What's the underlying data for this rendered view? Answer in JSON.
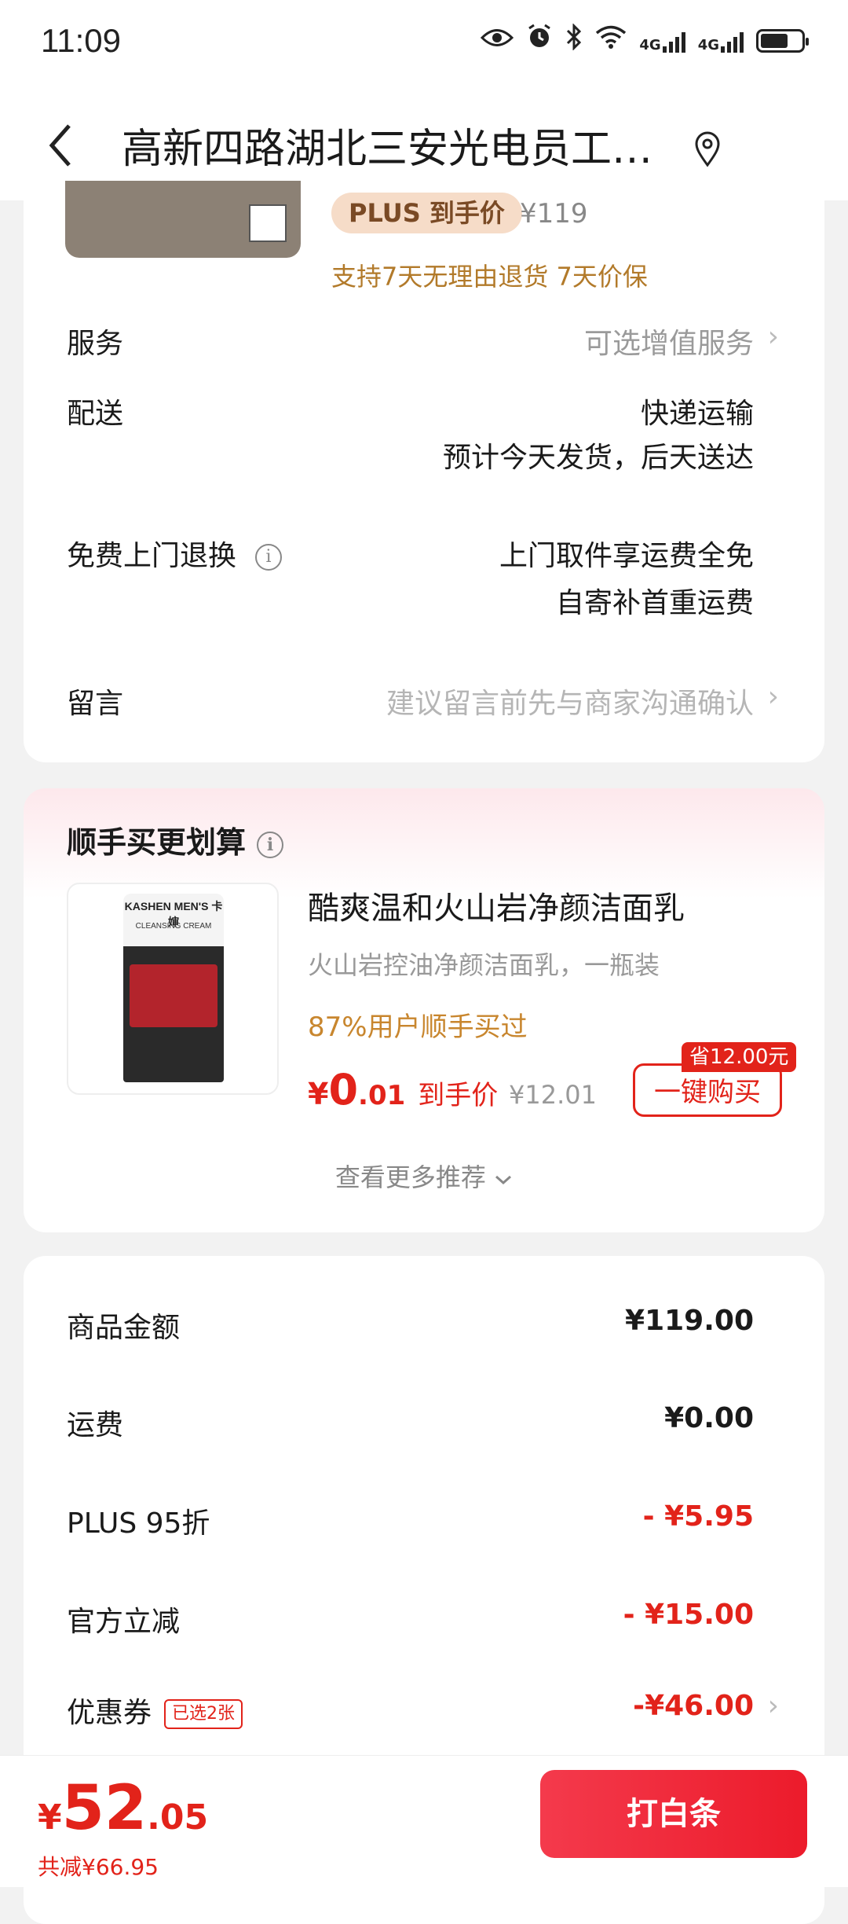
{
  "status_bar": {
    "time": "11:09",
    "net1": "4G",
    "net2": "4G"
  },
  "header": {
    "title": "高新四路湖北三安光电员工…"
  },
  "product": {
    "plus_tag": "PLUS 到手价",
    "orig_price": "¥119",
    "guarantee": "支持7天无理由退货  7天价保"
  },
  "rows": {
    "service_label": "服务",
    "service_value": "可选增值服务",
    "delivery_label": "配送",
    "delivery_line1": "快递运输",
    "delivery_line2": "预计今天发货，后天送达",
    "return_label": "免费上门退换",
    "return_line1": "上门取件享运费全免",
    "return_line2": "自寄补首重运费",
    "message_label": "留言",
    "message_placeholder": "建议留言前先与商家沟通确认"
  },
  "addon": {
    "section_title": "顺手买更划算",
    "image_brand": "KASHEN MEN'S 卡婶",
    "image_sub": "CLEANSING CREAM",
    "name": "酷爽温和火山岩净颜洁面乳",
    "desc": "火山岩控油净颜洁面乳，一瓶装",
    "buy_rate": "87%用户顺手买过",
    "price_yen": "¥",
    "price_int": "0",
    "price_dec": ".01",
    "price_label": "到手价",
    "orig_price": "¥12.01",
    "save_tag": "省12.00元",
    "buy_button": "一键购买",
    "more": "查看更多推荐"
  },
  "summary": {
    "goods_label": "商品金额",
    "goods_value": "¥119.00",
    "shipping_label": "运费",
    "shipping_value": "¥0.00",
    "plus_label": "PLUS 95折",
    "plus_value": "- ¥5.95",
    "official_label": "官方立减",
    "official_value": "- ¥15.00",
    "coupon_label": "优惠券",
    "coupon_tag": "已选2张",
    "coupon_value": "-¥46.00"
  },
  "bottom": {
    "yen": "¥",
    "total_int": "52",
    "total_dec": ".05",
    "saved": "共减¥66.95",
    "pay_button": "打白条"
  },
  "colors": {
    "accent": "#e2231a",
    "gold": "#c8862e"
  },
  "icons": [
    "eye-icon",
    "alarm-icon",
    "bluetooth-icon",
    "wifi-icon",
    "signal-icon",
    "battery-icon",
    "back-icon",
    "location-pin-icon",
    "info-icon",
    "chevron-right-icon",
    "chevron-down-icon"
  ]
}
